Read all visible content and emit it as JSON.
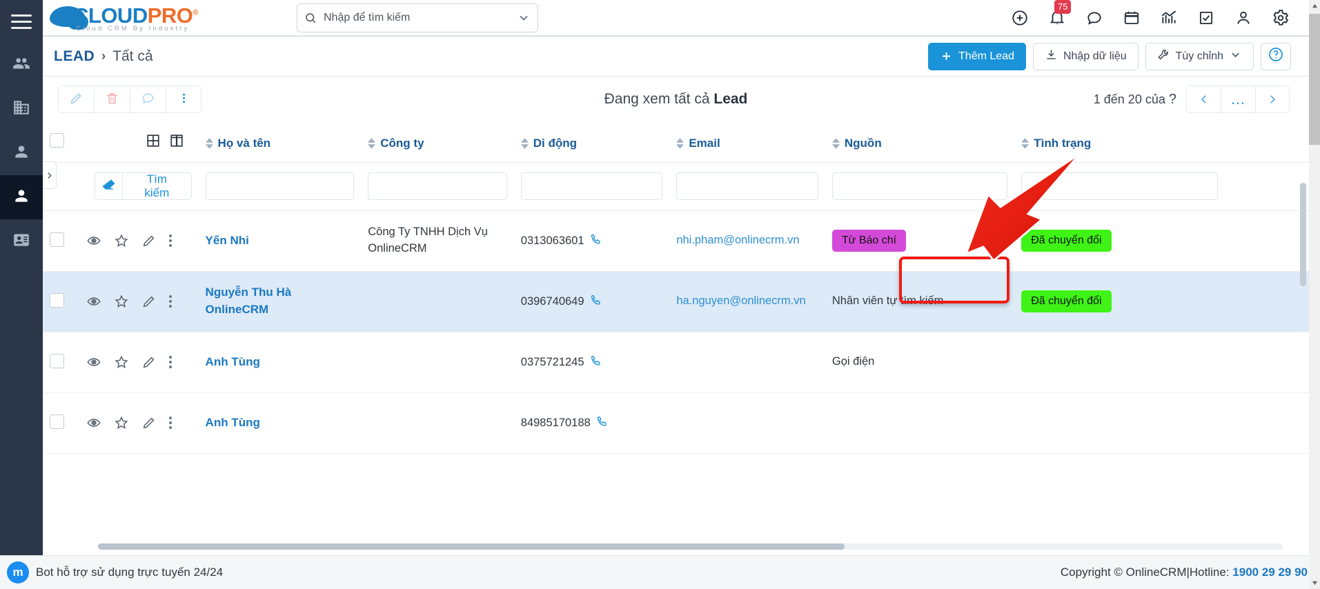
{
  "rail": {
    "menu_icon": "hamburger-menu-icon",
    "items": [
      {
        "name": "contacts-group",
        "icon": "people-icon",
        "active": false
      },
      {
        "name": "organizations",
        "icon": "building-icon",
        "active": false
      },
      {
        "name": "leads",
        "icon": "user-outline-icon",
        "active": false
      },
      {
        "name": "contacts",
        "icon": "user-filled-icon",
        "active": true
      },
      {
        "name": "reports",
        "icon": "id-card-icon",
        "active": false
      }
    ]
  },
  "header": {
    "logo": {
      "part1": "CLOUD",
      "part2": "PRO",
      "registered": "®",
      "tagline": "Cloud CRM By Industry"
    },
    "search": {
      "placeholder": "Nhập để tìm kiếm",
      "value": "",
      "icon": "search-icon",
      "caret": "chevron-down-icon"
    },
    "icons": [
      {
        "name": "add-icon",
        "badge": ""
      },
      {
        "name": "notification-bell-icon",
        "badge": "75"
      },
      {
        "name": "chat-bubble-icon",
        "badge": ""
      },
      {
        "name": "calendar-icon",
        "badge": ""
      },
      {
        "name": "analytics-chart-icon",
        "badge": ""
      },
      {
        "name": "task-checkbox-icon",
        "badge": ""
      },
      {
        "name": "user-account-icon",
        "badge": ""
      },
      {
        "name": "settings-gear-icon",
        "badge": ""
      }
    ]
  },
  "breadcrumb": {
    "root": "LEAD",
    "separator": "›",
    "current": "Tất cả"
  },
  "actions": {
    "add_lead": "Thêm Lead",
    "import": "Nhập dữ liệu",
    "customize": "Tùy chỉnh",
    "help": "?"
  },
  "toolbar": {
    "buttons": [
      {
        "name": "edit-button",
        "icon": "pencil-icon"
      },
      {
        "name": "delete-button",
        "icon": "trash-icon"
      },
      {
        "name": "comment-button",
        "icon": "chat-bubble-icon"
      },
      {
        "name": "more-options-button",
        "icon": "vertical-dots-icon"
      }
    ],
    "title_prefix": "Đang xem tất cả ",
    "title_bold": "Lead"
  },
  "pagination": {
    "range_text": "1 đến 20 của",
    "total": "?",
    "prev": "‹",
    "dots": "…",
    "next": "›"
  },
  "table": {
    "columns": [
      {
        "key": "name",
        "label": "Họ và tên"
      },
      {
        "key": "company",
        "label": "Công ty"
      },
      {
        "key": "phone",
        "label": "Di động"
      },
      {
        "key": "email",
        "label": "Email"
      },
      {
        "key": "source",
        "label": "Nguồn"
      },
      {
        "key": "status",
        "label": "Tình trạng"
      }
    ],
    "view_icons": [
      "grid-view-icon",
      "split-view-icon"
    ],
    "search_row": {
      "clear_icon": "eraser-icon",
      "search_label": "Tìm kiếm",
      "filters": {
        "name": "",
        "company": "",
        "phone": "",
        "email": "",
        "source": "",
        "status": ""
      }
    },
    "rows": [
      {
        "name": "Yến Nhi",
        "company": "Công Ty TNHH Dịch Vụ OnlineCRM",
        "phone": "0313063601",
        "email": "nhi.pham@onlinecrm.vn",
        "source": "Từ Báo chí",
        "source_is_pill": true,
        "source_color": "#d44ad8",
        "status": "Đã chuyển đổi",
        "status_color": "#3ef315",
        "alt": false
      },
      {
        "name": "Nguyễn Thu Hà OnlineCRM",
        "company": "",
        "phone": "0396740649",
        "email": "ha.nguyen@onlinecrm.vn",
        "source": "Nhân viên tự tìm kiếm",
        "source_is_pill": false,
        "source_color": "",
        "status": "Đã chuyển đổi",
        "status_color": "#3ef315",
        "alt": true
      },
      {
        "name": "Anh Tùng",
        "company": "",
        "phone": "0375721245",
        "email": "",
        "source": "Gọi điện",
        "source_is_pill": false,
        "source_color": "",
        "status": "",
        "status_color": "",
        "alt": false
      },
      {
        "name": "Anh Tùng",
        "company": "",
        "phone": "84985170188",
        "email": "",
        "source": "",
        "source_is_pill": false,
        "source_color": "",
        "status": "",
        "status_color": "",
        "alt": false
      }
    ],
    "row_action_icons": [
      "eye-icon",
      "star-icon",
      "pencil-icon",
      "vertical-dots-icon"
    ]
  },
  "annotation": {
    "highlight_color": "#f01c14",
    "arrow_color": "#ef2b20",
    "target": "Từ Báo chí"
  },
  "footer": {
    "bot_text": "Bot hỗ trợ sử dụng trực tuyến 24/24",
    "bot_icon": "messenger-icon",
    "copyright": "Copyright © OnlineCRM|Hotline: ",
    "hotline": "1900 29 29 90"
  }
}
